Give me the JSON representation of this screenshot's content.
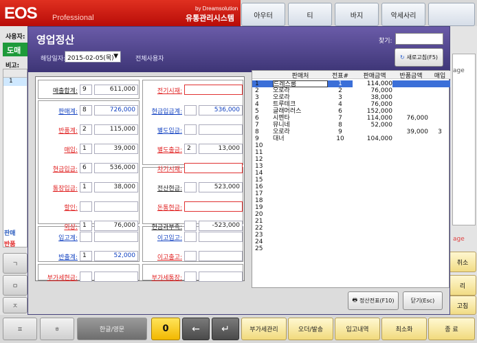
{
  "app": {
    "logo": "EOS",
    "logo_sub": "Professional",
    "by": "by Dreamsolution",
    "brand": "유통관리시스템"
  },
  "categories": [
    "아우터",
    "티",
    "바지",
    "악세사리",
    ""
  ],
  "left": {
    "user_label": "사용자:",
    "store": "도매",
    "memo": "비고:",
    "row_no": "1",
    "sales_label": "판매",
    "return_label": "반품",
    "keys": [
      "ㄱ",
      "ㅁ",
      "ㅈ"
    ]
  },
  "right": {
    "page_text_1": "age",
    "page_text_2": "age",
    "btn_cancel": "취소",
    "btn_2": "리",
    "btn_3": "고침"
  },
  "bottom": {
    "key1": "ㅍ",
    "key2": "ㅎ",
    "lang": "한글/영문",
    "zero": "0",
    "back": "←",
    "enter": "↵",
    "buttons": [
      "부가세관리",
      "오더/발송",
      "입고내역",
      "최소화",
      "종  료"
    ]
  },
  "dialog": {
    "title": "영업정산",
    "date_label": "해당일자:",
    "date": "2015-02-05(목)",
    "all_users": "전체사용자",
    "find_label": "찾기:",
    "refresh": "새로고침(F5)",
    "print": "정산전표(F10)",
    "close": "닫기(Esc)"
  },
  "summary": {
    "left": [
      {
        "label": "매출합계:",
        "count": "9",
        "amount": "611,000",
        "color": "bk"
      },
      {
        "label": "판매계:",
        "count": "8",
        "amount": "726,000",
        "color": "blue"
      },
      {
        "label": "반품계:",
        "count": "2",
        "amount": "115,000",
        "color": "red"
      },
      {
        "label": "매입:",
        "count": "1",
        "amount": "39,000",
        "color": "red"
      },
      {
        "label": "현금입금:",
        "count": "6",
        "amount": "536,000",
        "color": "red"
      },
      {
        "label": "통장입금:",
        "count": "1",
        "amount": "38,000",
        "color": "red"
      },
      {
        "label": "할인:",
        "count": "",
        "amount": "",
        "color": "red"
      },
      {
        "label": "외상:",
        "count": "1",
        "amount": "76,000",
        "color": "red"
      },
      {
        "label": "입고계:",
        "count": "",
        "amount": "",
        "color": "blue"
      },
      {
        "label": "반출계:",
        "count": "1",
        "amount": "52,000",
        "color": "blue"
      },
      {
        "label": "부가세현금:",
        "count": "",
        "amount": "",
        "color": "red"
      }
    ],
    "right": [
      {
        "label": "전기시재:",
        "count": "",
        "amount": "",
        "color": "red"
      },
      {
        "label": "현금입금계:",
        "count": "",
        "amount": "536,000",
        "color": "blue"
      },
      {
        "label": "별도입금:",
        "count": "",
        "amount": "",
        "color": "blue"
      },
      {
        "label": "별도출금:",
        "count": "2",
        "amount": "13,000",
        "color": "red"
      },
      {
        "label": "차기시재:",
        "count": "",
        "amount": "",
        "color": "red"
      },
      {
        "label": "전산현금:",
        "count": "",
        "amount": "523,000",
        "color": "bk"
      },
      {
        "label": "돈통현금:",
        "count": "",
        "amount": "",
        "color": "red"
      },
      {
        "label": "현금과부족:",
        "count": "",
        "amount": "-523,000",
        "color": "bk"
      },
      {
        "label": "이고입고:",
        "count": "",
        "amount": "",
        "color": "blue"
      },
      {
        "label": "이고출고:",
        "count": "",
        "amount": "",
        "color": "red"
      },
      {
        "label": "부가세통장:",
        "count": "",
        "amount": "",
        "color": "red"
      }
    ]
  },
  "grid": {
    "headers": [
      "판매처",
      "전표#",
      "판매금액",
      "반품금액",
      "매입"
    ],
    "rows": [
      {
        "no": "1",
        "name": "드레스룸",
        "slip": "1",
        "sale": "114,000",
        "ret": "",
        "buy": ""
      },
      {
        "no": "2",
        "name": "오로라",
        "slip": "2",
        "sale": "76,000",
        "ret": "",
        "buy": ""
      },
      {
        "no": "3",
        "name": "오로라",
        "slip": "3",
        "sale": "38,000",
        "ret": "",
        "buy": ""
      },
      {
        "no": "4",
        "name": "트루테크",
        "slip": "4",
        "sale": "76,000",
        "ret": "",
        "buy": ""
      },
      {
        "no": "5",
        "name": "글래머러스",
        "slip": "6",
        "sale": "152,000",
        "ret": "",
        "buy": ""
      },
      {
        "no": "6",
        "name": "시멘타",
        "slip": "7",
        "sale": "114,000",
        "ret": "76,000",
        "buy": ""
      },
      {
        "no": "7",
        "name": "뮤니네",
        "slip": "8",
        "sale": "52,000",
        "ret": "",
        "buy": ""
      },
      {
        "no": "8",
        "name": "오로라",
        "slip": "9",
        "sale": "",
        "ret": "39,000",
        "buy": "3"
      },
      {
        "no": "9",
        "name": "대너",
        "slip": "10",
        "sale": "104,000",
        "ret": "",
        "buy": ""
      }
    ],
    "empty_rows": [
      "10",
      "11",
      "12",
      "13",
      "14",
      "15",
      "16",
      "17",
      "18",
      "19",
      "20",
      "21",
      "22",
      "23",
      "24",
      "25"
    ]
  },
  "colors": {
    "title_bar": "#6a5ba8",
    "top_bar": "#d01810",
    "selected_row": "#3b6fd8"
  }
}
